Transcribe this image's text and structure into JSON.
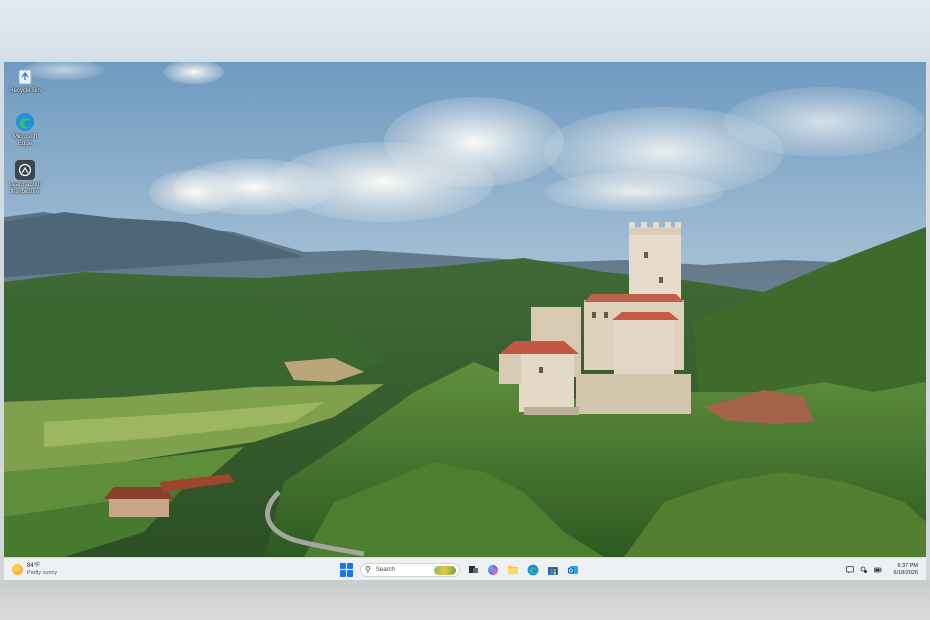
{
  "desktop": {
    "icons": [
      {
        "label": "Recycle Bin",
        "icon": "recycle-bin-icon"
      },
      {
        "label": "Microsoft Edge",
        "icon": "edge-icon"
      },
      {
        "label": "Learn about this picture",
        "icon": "learn-picture-icon"
      }
    ]
  },
  "taskbar": {
    "weather": {
      "temp": "84°F",
      "condition": "Partly sunny",
      "icon": "sun-icon"
    },
    "search_placeholder": "Search",
    "apps": [
      {
        "name": "task-view-icon"
      },
      {
        "name": "copilot-icon"
      },
      {
        "name": "file-explorer-icon"
      },
      {
        "name": "edge-icon"
      },
      {
        "name": "microsoft-store-icon"
      },
      {
        "name": "outlook-icon"
      }
    ],
    "clock": {
      "time": "6:37 PM",
      "date": "6/18/2026"
    }
  },
  "colors": {
    "accent": "#1a73e8",
    "taskbar_bg": "#eef1f4"
  }
}
